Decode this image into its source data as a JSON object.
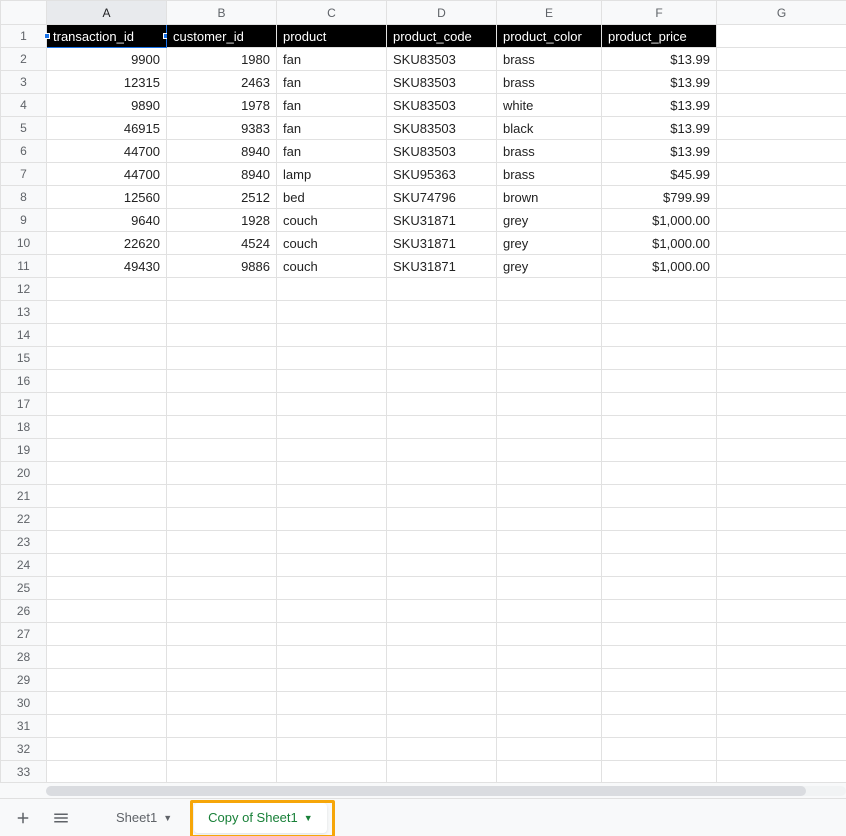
{
  "columns": [
    "A",
    "B",
    "C",
    "D",
    "E",
    "F",
    "G"
  ],
  "header_row": [
    "transaction_id",
    "customer_id",
    "product",
    "product_code",
    "product_color",
    "product_price"
  ],
  "rows": [
    {
      "transaction_id": "9900",
      "customer_id": "1980",
      "product": "fan",
      "product_code": "SKU83503",
      "product_color": "brass",
      "product_price": "$13.99"
    },
    {
      "transaction_id": "12315",
      "customer_id": "2463",
      "product": "fan",
      "product_code": "SKU83503",
      "product_color": "brass",
      "product_price": "$13.99"
    },
    {
      "transaction_id": "9890",
      "customer_id": "1978",
      "product": "fan",
      "product_code": "SKU83503",
      "product_color": "white",
      "product_price": "$13.99"
    },
    {
      "transaction_id": "46915",
      "customer_id": "9383",
      "product": "fan",
      "product_code": "SKU83503",
      "product_color": "black",
      "product_price": "$13.99"
    },
    {
      "transaction_id": "44700",
      "customer_id": "8940",
      "product": "fan",
      "product_code": "SKU83503",
      "product_color": "brass",
      "product_price": "$13.99"
    },
    {
      "transaction_id": "44700",
      "customer_id": "8940",
      "product": "lamp",
      "product_code": "SKU95363",
      "product_color": "brass",
      "product_price": "$45.99"
    },
    {
      "transaction_id": "12560",
      "customer_id": "2512",
      "product": "bed",
      "product_code": "SKU74796",
      "product_color": "brown",
      "product_price": "$799.99"
    },
    {
      "transaction_id": "9640",
      "customer_id": "1928",
      "product": "couch",
      "product_code": "SKU31871",
      "product_color": "grey",
      "product_price": "$1,000.00"
    },
    {
      "transaction_id": "22620",
      "customer_id": "4524",
      "product": "couch",
      "product_code": "SKU31871",
      "product_color": "grey",
      "product_price": "$1,000.00"
    },
    {
      "transaction_id": "49430",
      "customer_id": "9886",
      "product": "couch",
      "product_code": "SKU31871",
      "product_color": "grey",
      "product_price": "$1,000.00"
    }
  ],
  "total_display_rows": 33,
  "tabs": {
    "add_tooltip": "Add Sheet",
    "all_tooltip": "All Sheets",
    "tab1": "Sheet1",
    "tab2": "Copy of Sheet1"
  },
  "selected_cell": "A1",
  "active_column": "A"
}
